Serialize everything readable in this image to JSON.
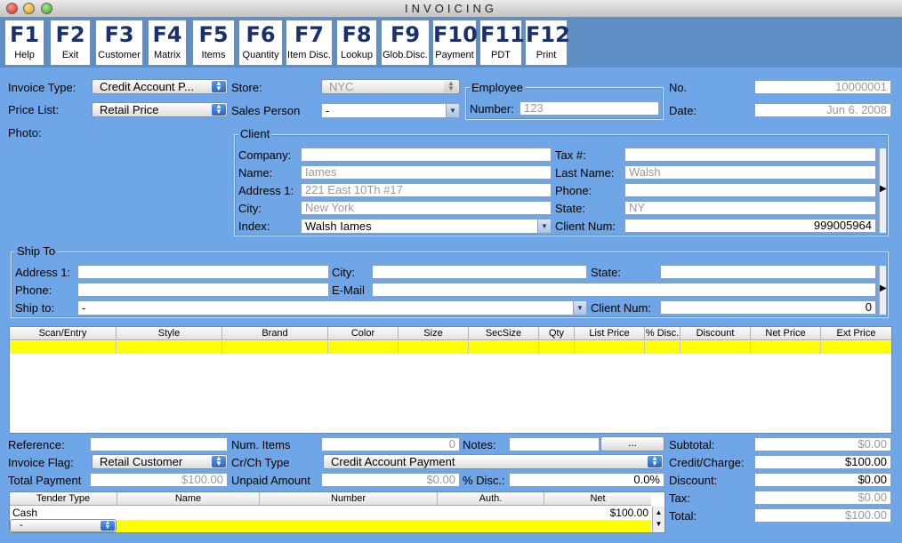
{
  "window": {
    "title": "INVOICING"
  },
  "toolbar": [
    {
      "key": "F1",
      "label": "Help"
    },
    {
      "key": "F2",
      "label": "Exit"
    },
    {
      "key": "F3",
      "label": "Customer"
    },
    {
      "key": "F4",
      "label": "Matrix"
    },
    {
      "key": "F5",
      "label": "Items"
    },
    {
      "key": "F6",
      "label": "Quantity"
    },
    {
      "key": "F7",
      "label": "Item Disc."
    },
    {
      "key": "F8",
      "label": "Lookup"
    },
    {
      "key": "F9",
      "label": "Glob.Disc."
    },
    {
      "key": "F10",
      "label": "Payment"
    },
    {
      "key": "F11",
      "label": "PDT"
    },
    {
      "key": "F12",
      "label": "Print"
    }
  ],
  "header": {
    "invoice_type_label": "Invoice Type:",
    "invoice_type": "Credit Account P...",
    "price_list_label": "Price List:",
    "price_list": "Retail Price",
    "photo_label": "Photo:",
    "store_label": "Store:",
    "store": "NYC",
    "sales_person_label": "Sales Person",
    "sales_person": "-",
    "employee_title": "Employee",
    "employee_number_label": "Number:",
    "employee_number": "123",
    "no_label": "No.",
    "no": "10000001",
    "date_label": "Date:",
    "date": "Jun 6. 2008"
  },
  "client": {
    "title": "Client",
    "company_label": "Company:",
    "company": "",
    "name_label": "Name:",
    "name": "Iames",
    "address_label": "Address 1:",
    "address": "221 East 10Th #17",
    "city_label": "City:",
    "city": "New York",
    "index_label": "Index:",
    "index": "Walsh Iames",
    "tax_label": "Tax #:",
    "tax": "",
    "last_name_label": "Last Name:",
    "last_name": "Walsh",
    "phone_label": "Phone:",
    "phone": "",
    "state_label": "State:",
    "state": "NY",
    "client_num_label": "Client Num:",
    "client_num": "999005964"
  },
  "ship_to": {
    "title": "Ship To",
    "address_label": "Address 1:",
    "address": "",
    "phone_label": "Phone:",
    "phone": "",
    "ship_to_label": "Ship to:",
    "ship_to": "-",
    "city_label": "City:",
    "city": "",
    "email_label": "E-Mail",
    "email": "",
    "state_label": "State:",
    "state": "",
    "client_num_label": "Client Num:",
    "client_num": "0"
  },
  "items_table": {
    "columns": [
      "Scan/Entry",
      "Style",
      "Brand",
      "Color",
      "Size",
      "SecSize",
      "Qty",
      "List Price",
      "% Disc.",
      "Discount",
      "Net Price",
      "Ext Price"
    ]
  },
  "footer": {
    "reference_label": "Reference:",
    "reference": "",
    "invoice_flag_label": "Invoice Flag:",
    "invoice_flag": "Retail Customer",
    "total_payment_label": "Total Payment",
    "total_payment": "$100.00",
    "num_items_label": "Num. Items",
    "num_items": "0",
    "crch_type_label": "Cr/Ch Type",
    "crch_type": "Credit Account Payment",
    "unpaid_amount_label": "Unpaid Amount",
    "unpaid_amount": "$0.00",
    "notes_label": "Notes:",
    "notes": "",
    "notes_button": "...",
    "disc_pct_label": "% Disc.:",
    "disc_pct": "0.0%",
    "subtotal_label": "Subtotal:",
    "subtotal": "$0.00",
    "credit_charge_label": "Credit/Charge:",
    "credit_charge": "$100.00",
    "discount_label": "Discount:",
    "discount": "$0.00",
    "tax_label": "Tax:",
    "tax": "$0.00",
    "total_label": "Total:",
    "total": "$100.00"
  },
  "tender_table": {
    "columns": [
      "Tender Type",
      "Name",
      "Number",
      "Auth.",
      "Net"
    ],
    "rows": [
      {
        "type": "Cash",
        "net": "$100.00"
      }
    ],
    "new_row_type": "-"
  }
}
